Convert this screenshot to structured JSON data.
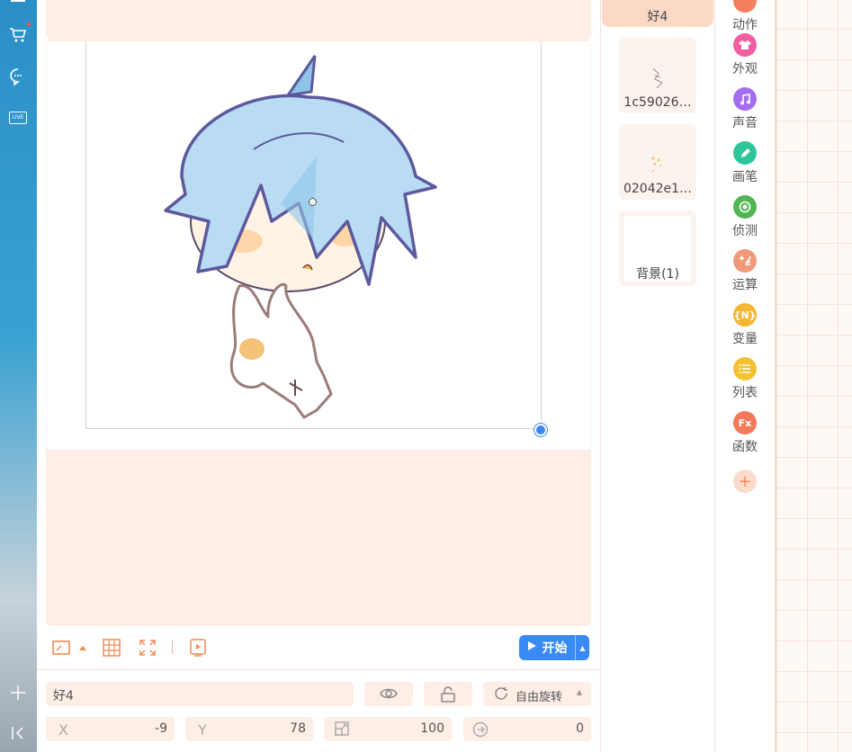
{
  "sidebar": {
    "icons": [
      "menu-icon",
      "cart-icon",
      "chat-icon",
      "live-icon",
      "add-icon",
      "collapse-icon"
    ],
    "live_label": "LIVE"
  },
  "stage": {
    "start_label": "开始"
  },
  "props": {
    "name": "好4",
    "rotation_label": "自由旋转",
    "x_label": "X",
    "x": "-9",
    "y_label": "Y",
    "y": "78",
    "size": "100",
    "direction": "0"
  },
  "sprites": {
    "selected": "好4",
    "items": [
      {
        "name": "1c59026…"
      },
      {
        "name": "02042e1…"
      },
      {
        "name": "背景(1)"
      }
    ]
  },
  "categories": [
    {
      "label": "动作",
      "color": "#f27f5f",
      "icon": ""
    },
    {
      "label": "外观",
      "color": "#f05fa2",
      "icon": "shirt-icon"
    },
    {
      "label": "声音",
      "color": "#a46cf0",
      "icon": "music-icon"
    },
    {
      "label": "画笔",
      "color": "#2ec59a",
      "icon": "pen-icon"
    },
    {
      "label": "侦测",
      "color": "#52b553",
      "icon": "target-icon"
    },
    {
      "label": "运算",
      "color": "#f09a7a",
      "icon": "calc-icon"
    },
    {
      "label": "变量",
      "color": "#f5b632",
      "icon_text": "{N}"
    },
    {
      "label": "列表",
      "color": "#f5c22f",
      "icon": "list-icon"
    },
    {
      "label": "函数",
      "color": "#f27a5a",
      "icon_text": "Fx"
    }
  ]
}
